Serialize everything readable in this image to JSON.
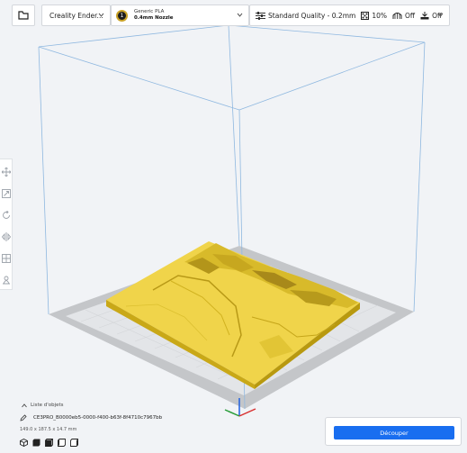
{
  "topbar": {
    "printer": "Creality Ender...",
    "material": {
      "brand_line": "Generic PLA",
      "nozzle_line": "0.4mm Nozzle",
      "badge": "1"
    },
    "settings": {
      "profile": "Standard Quality - 0.2mm",
      "infill": "10%",
      "support": "Off",
      "adhesion": "Off"
    }
  },
  "objects": {
    "header": "Liste d'objets",
    "item_name": "CE3PRO_B0000eb5-0000-f400-b63f-8f4710c7967bb",
    "dimensions": "149.0 x 187.5 x 14.7 mm"
  },
  "slice": {
    "button_label": "Découper"
  },
  "icons": {
    "open": "folder-icon",
    "sidebar": [
      "move-icon",
      "scale-icon",
      "rotate-icon",
      "mirror-icon",
      "per-model-settings-icon",
      "support-blocker-icon"
    ],
    "views": [
      "3d-view-icon",
      "front-view-icon",
      "top-view-icon",
      "left-view-icon",
      "right-view-icon"
    ]
  },
  "colors": {
    "model": "#f0d44a",
    "accent": "#196ef0",
    "build_plate": "#c8cacd"
  }
}
